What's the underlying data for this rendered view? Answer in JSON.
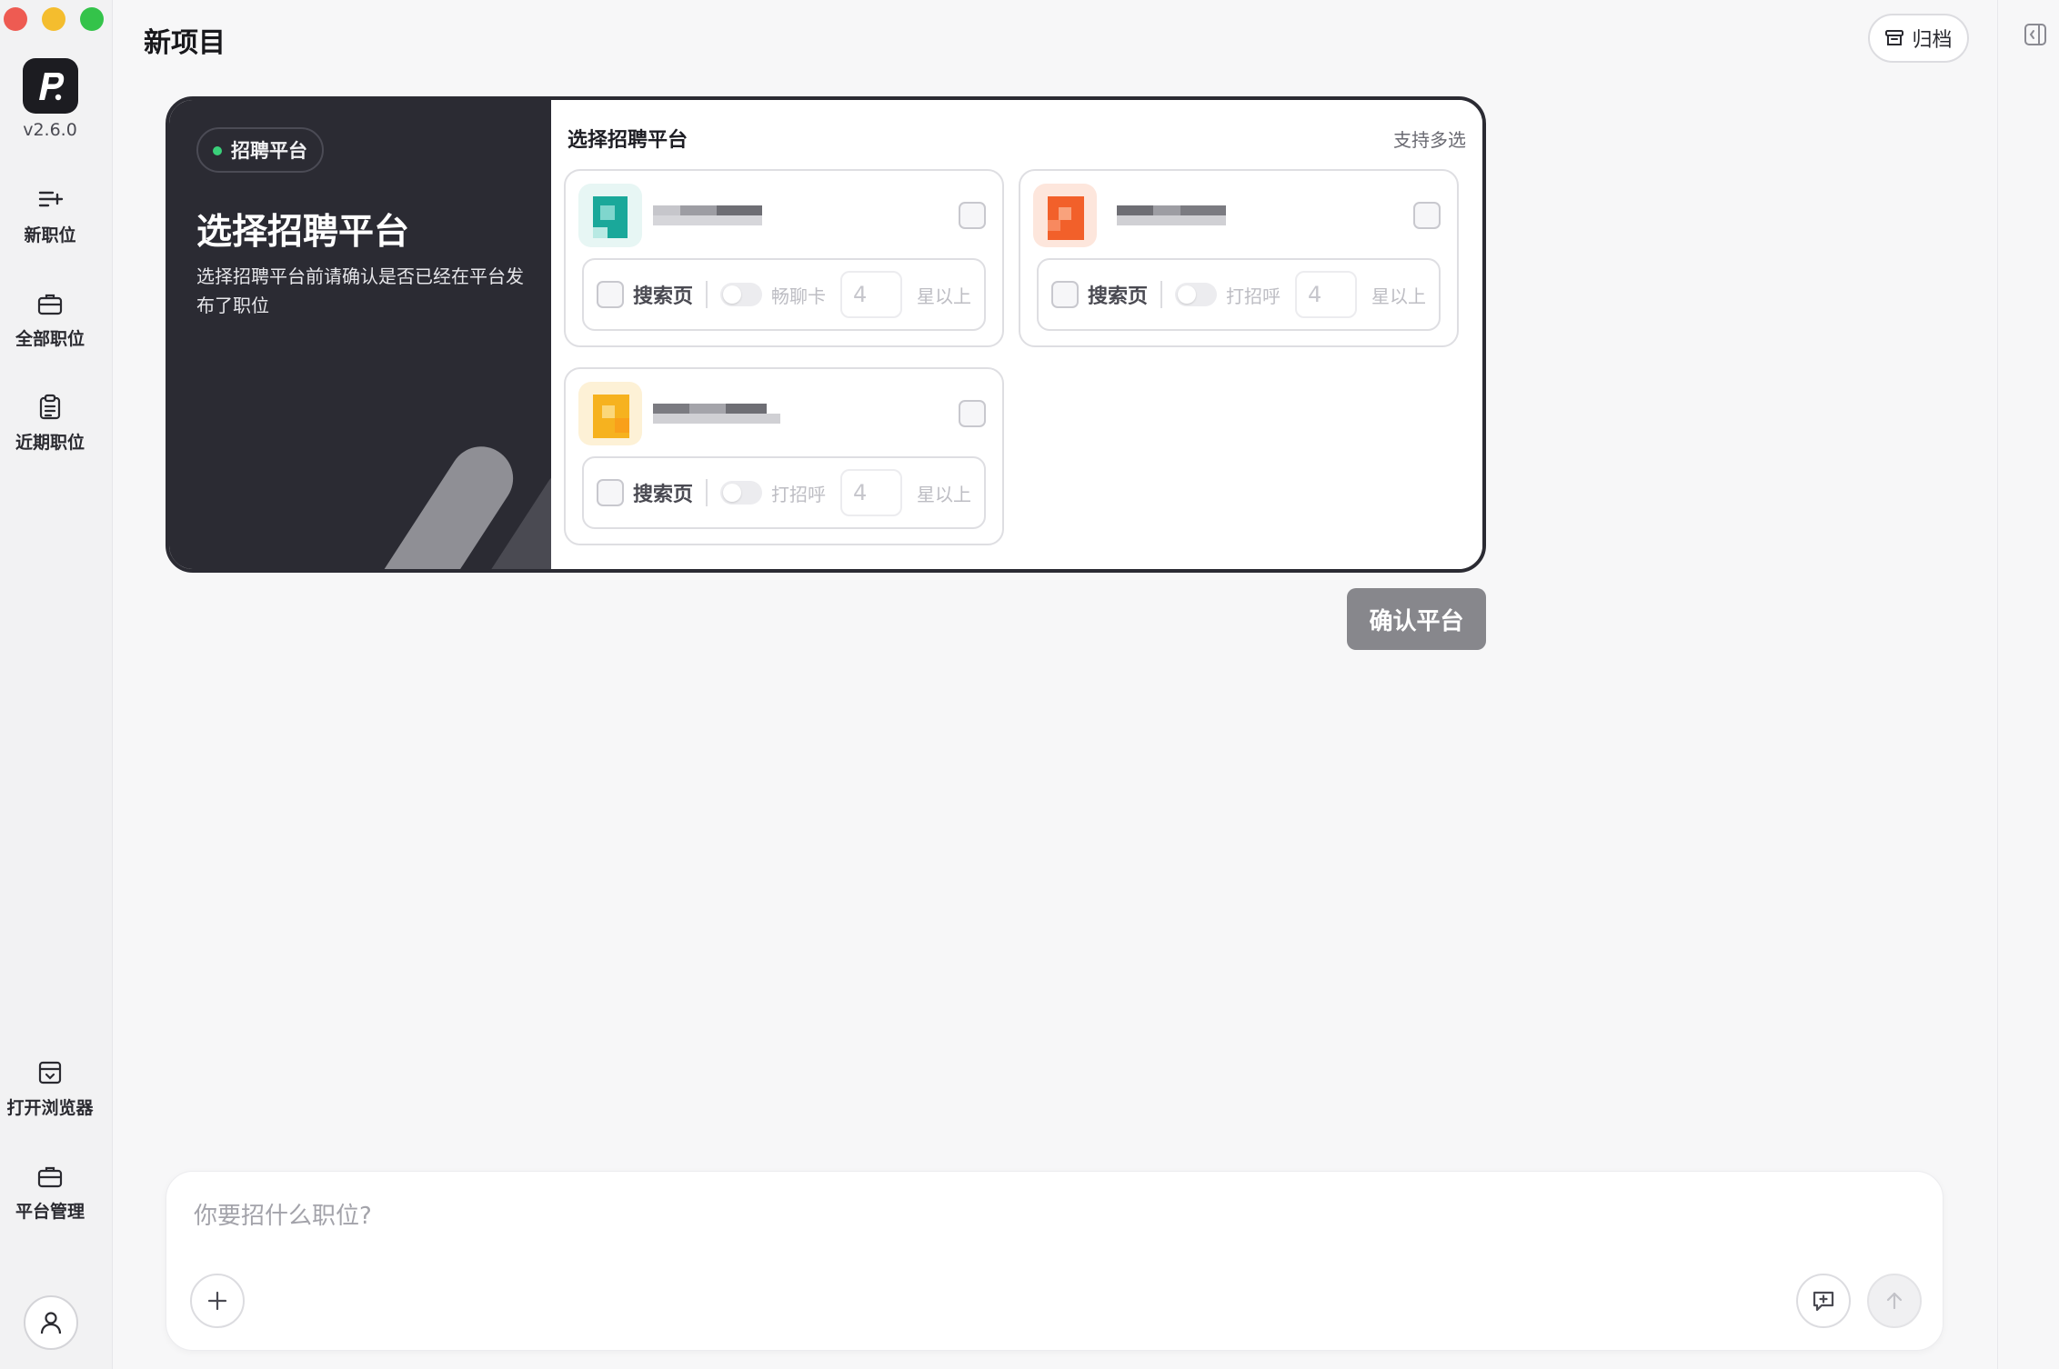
{
  "app": {
    "version": "v2.6.0"
  },
  "sidebar": {
    "items": [
      {
        "label": "新职位",
        "icon": "new-job-icon"
      },
      {
        "label": "全部职位",
        "icon": "briefcase-icon"
      },
      {
        "label": "近期职位",
        "icon": "clipboard-icon"
      }
    ],
    "bottom_items": [
      {
        "label": "打开浏览器",
        "icon": "browser-icon"
      },
      {
        "label": "平台管理",
        "icon": "briefcase-icon"
      }
    ]
  },
  "header": {
    "title": "新项目",
    "archive_label": "归档"
  },
  "card": {
    "tag": "招聘平台",
    "title": "选择招聘平台",
    "description": "选择招聘平台前请确认是否已经在平台发布了职位",
    "section_title": "选择招聘平台",
    "multi_select_note": "支持多选",
    "platforms": [
      {
        "option_label": "搜索页",
        "action_label": "畅聊卡",
        "star_value": "4",
        "star_suffix": "星以上",
        "logo_color": "#1aa89a"
      },
      {
        "option_label": "搜索页",
        "action_label": "打招呼",
        "star_value": "4",
        "star_suffix": "星以上",
        "logo_color": "#f2602a"
      },
      {
        "option_label": "搜索页",
        "action_label": "打招呼",
        "star_value": "4",
        "star_suffix": "星以上",
        "logo_color": "#f6b21f"
      }
    ]
  },
  "confirm_label": "确认平台",
  "chat": {
    "placeholder": "你要招什么职位?"
  }
}
